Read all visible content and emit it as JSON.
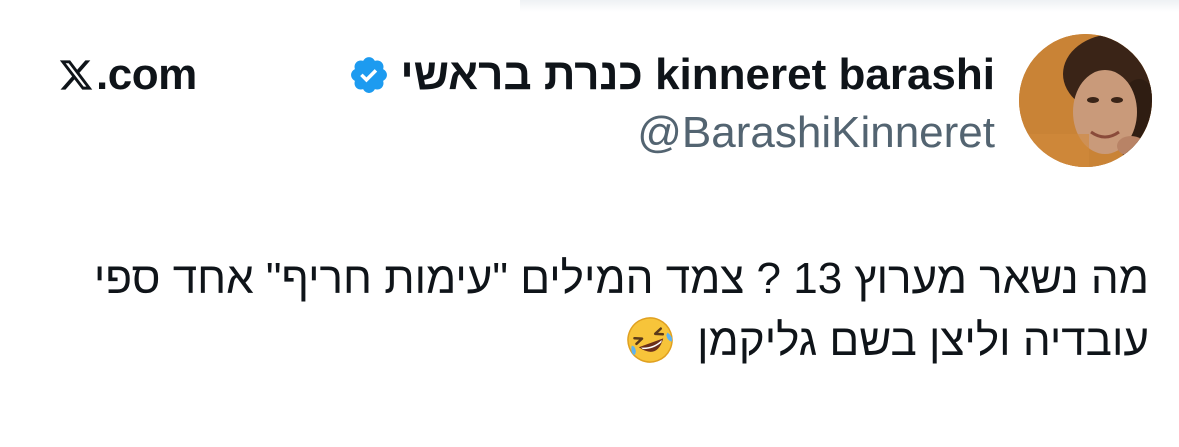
{
  "site": {
    "label": ".com",
    "logo_icon": "x-logo-icon"
  },
  "author": {
    "display_name": "כנרת בראשי kinneret barashi",
    "handle": "@BarashiKinneret",
    "verified": true,
    "avatar_icon": "avatar-photo"
  },
  "tweet": {
    "line1": "מה נשאר מערוץ 13 ? צמד המילים \"עימות חריף\" אחד ספי",
    "line2": "עובדיה וליצן בשם גליקמן",
    "emoji": "rolling-on-floor-laughing-emoji"
  },
  "colors": {
    "text": "#0f1419",
    "handle": "#536471",
    "verified": "#1d9bf0"
  }
}
